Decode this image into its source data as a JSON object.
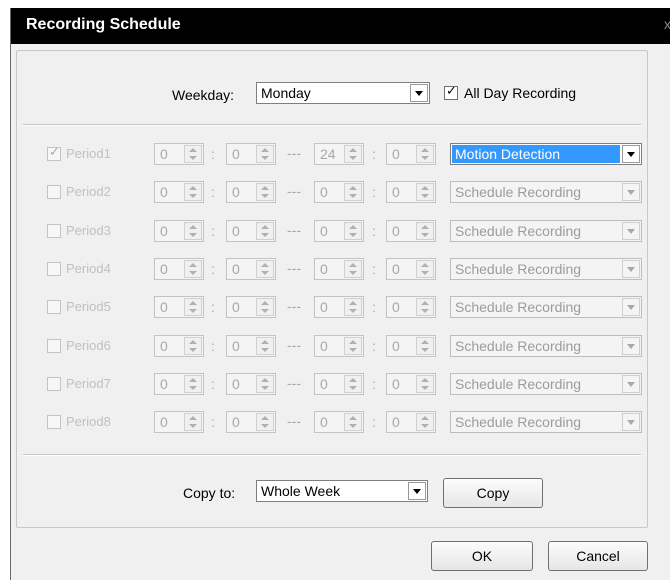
{
  "window": {
    "title": "Recording Schedule",
    "close_glyph": "x"
  },
  "weekday": {
    "label": "Weekday:",
    "value": "Monday"
  },
  "all_day": {
    "label": "All Day Recording",
    "checked": true
  },
  "periods": [
    {
      "label": "Period1",
      "checked": true,
      "start_h": "0",
      "start_m": "0",
      "end_h": "24",
      "end_m": "0",
      "mode": "Motion Detection"
    },
    {
      "label": "Period2",
      "checked": false,
      "start_h": "0",
      "start_m": "0",
      "end_h": "0",
      "end_m": "0",
      "mode": "Schedule Recording"
    },
    {
      "label": "Period3",
      "checked": false,
      "start_h": "0",
      "start_m": "0",
      "end_h": "0",
      "end_m": "0",
      "mode": "Schedule Recording"
    },
    {
      "label": "Period4",
      "checked": false,
      "start_h": "0",
      "start_m": "0",
      "end_h": "0",
      "end_m": "0",
      "mode": "Schedule Recording"
    },
    {
      "label": "Period5",
      "checked": false,
      "start_h": "0",
      "start_m": "0",
      "end_h": "0",
      "end_m": "0",
      "mode": "Schedule Recording"
    },
    {
      "label": "Period6",
      "checked": false,
      "start_h": "0",
      "start_m": "0",
      "end_h": "0",
      "end_m": "0",
      "mode": "Schedule Recording"
    },
    {
      "label": "Period7",
      "checked": false,
      "start_h": "0",
      "start_m": "0",
      "end_h": "0",
      "end_m": "0",
      "mode": "Schedule Recording"
    },
    {
      "label": "Period8",
      "checked": false,
      "start_h": "0",
      "start_m": "0",
      "end_h": "0",
      "end_m": "0",
      "mode": "Schedule Recording"
    }
  ],
  "time_sep": ":",
  "range_sep": "---",
  "copy_to": {
    "label": "Copy to:",
    "value": "Whole Week",
    "button": "Copy"
  },
  "buttons": {
    "ok": "OK",
    "cancel": "Cancel"
  }
}
